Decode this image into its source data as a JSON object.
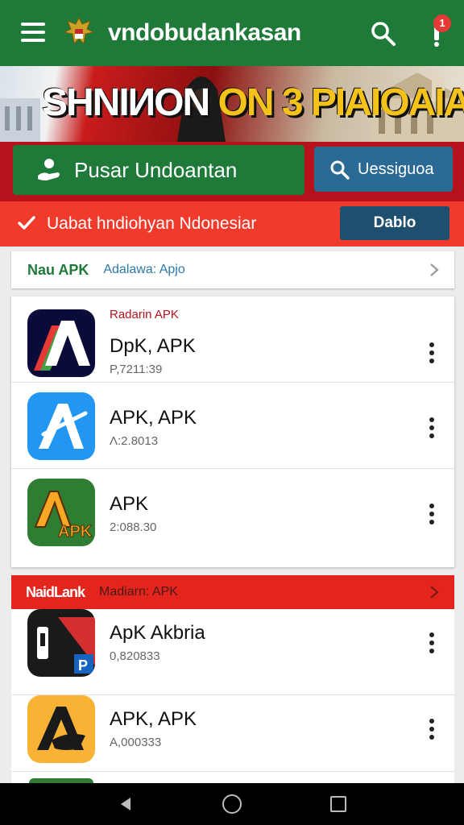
{
  "header": {
    "title": "vndobudankasan",
    "notification_count": "1"
  },
  "banner": {
    "text_white": "SHNIИON",
    "text_yellow": "ON 3",
    "text_white2": "PIAIOAIA"
  },
  "actions": {
    "primary_label": "Pusar Undoantan",
    "search_label": "Uessiguoa"
  },
  "notice": {
    "text": "Uabat hndiohyan Ndonesiar",
    "button_label": "Dablo"
  },
  "section1": {
    "title": "Nau APK",
    "subtitle": "Adalawa: Apjo"
  },
  "section2": {
    "title": "NaidLank",
    "subtitle": "Madiarn: APK"
  },
  "apps": [
    {
      "tag": "Radarin APK",
      "name": "DpK, APK",
      "version": "P,7211:39"
    },
    {
      "tag": "",
      "name": "APK, APK",
      "version": "Λ:2.8013"
    },
    {
      "tag": "",
      "name": "APK",
      "version": "2:088.30"
    },
    {
      "tag": "",
      "name": "ApK Akbria",
      "version": "0,820833"
    },
    {
      "tag": "",
      "name": "APK, APK",
      "version": "A,000333"
    }
  ],
  "colors": {
    "green": "#1f7a3a",
    "red": "#e4251e",
    "dark_red": "#b5121b",
    "blue": "#2b6a94"
  }
}
